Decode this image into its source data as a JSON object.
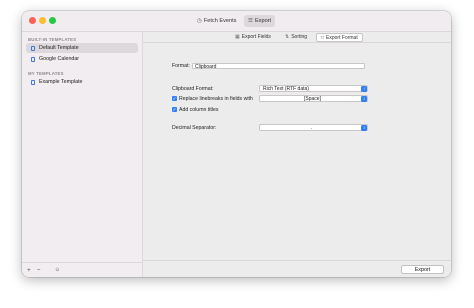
{
  "toolbar": {
    "fetch_events_label": "Fetch Events",
    "export_label": "Export"
  },
  "sidebar": {
    "builtin_title": "BUILT-IN TEMPLATES",
    "builtin_items": [
      {
        "label": "Default Template",
        "selected": true
      },
      {
        "label": "Google Calendar",
        "selected": false
      }
    ],
    "my_title": "MY TEMPLATES",
    "my_items": [
      {
        "label": "Example Template",
        "selected": false
      }
    ],
    "footer": {
      "add": "+",
      "remove": "−",
      "more": "☺"
    }
  },
  "tabs": {
    "export_fields": "Export Fields",
    "sorting": "Sorting",
    "export_format": "Export Format"
  },
  "form": {
    "format_label": "Format:",
    "format_value": "Clipboard",
    "clipboard_format_label": "Clipboard Format:",
    "clipboard_format_value": "Rich Text (RTF data)",
    "replace_linebreaks_label": "Replace linebreaks in fields with",
    "replace_linebreaks_checked": true,
    "replace_linebreaks_value": "[Space]",
    "add_column_titles_label": "Add column titles",
    "add_column_titles_checked": true,
    "decimal_separator_label": "Decimal Separator:",
    "decimal_separator_value": "."
  },
  "footer": {
    "export_button": "Export"
  },
  "colors": {
    "accent": "#2f7ff6",
    "close": "#fe5f57",
    "minimize": "#febc2e",
    "zoom": "#28c840"
  }
}
